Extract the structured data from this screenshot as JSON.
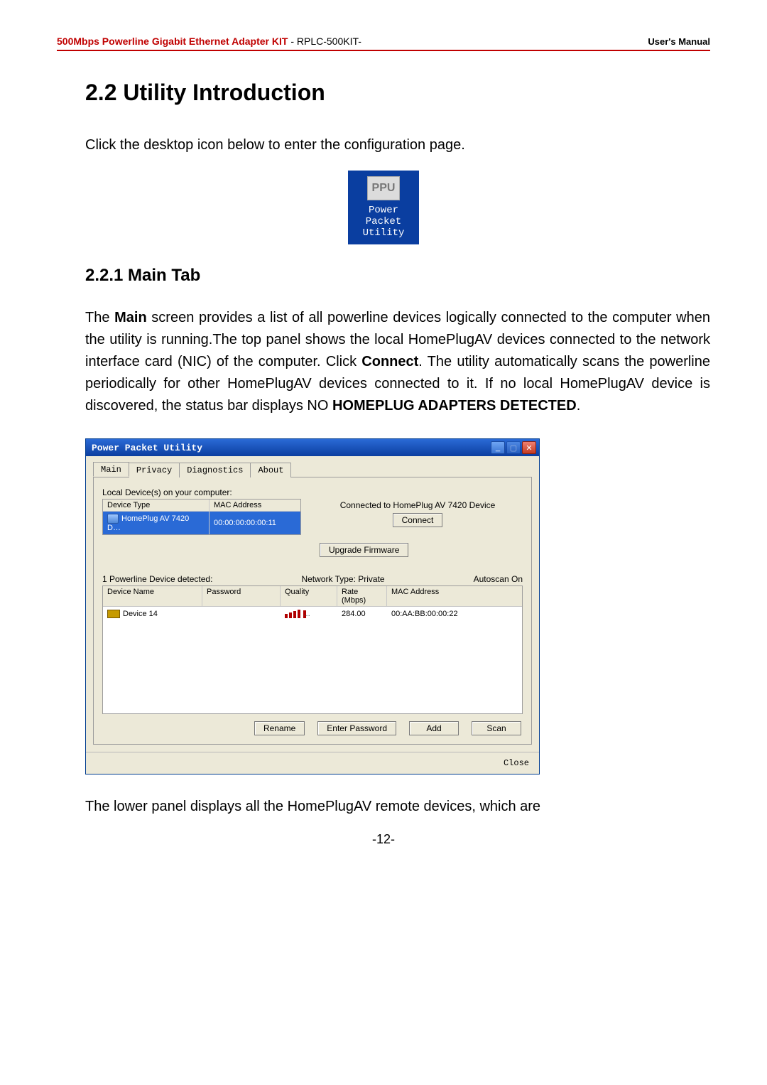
{
  "header": {
    "product": "500Mbps Powerline Gigabit Ethernet Adapter KIT",
    "separator": "  -",
    "model": " RPLC-500KIT-",
    "right": "User's Manual"
  },
  "section": {
    "number_title": "2.2 Utility Introduction",
    "intro": "Click the desktop icon below to enter the configuration page."
  },
  "desktop_icon": {
    "badge": "PPU",
    "line1": "Power",
    "line2": "Packet",
    "line3": "Utility"
  },
  "subsection": {
    "number_title": "2.2.1 Main Tab",
    "para_pre": "The ",
    "para_main": "Main",
    "para_mid1": " screen provides a list of all powerline devices logically connected to the computer when the utility is running.The top panel shows the local HomePlugAV devices connected to the network interface card (NIC) of the computer. Click ",
    "para_connect": "Connect",
    "para_mid2": ". The utility automatically scans the powerline periodically for other HomePlugAV devices connected to it. If no local HomePlugAV device is discovered, the status bar displays NO ",
    "para_h_adapters": "HOMEPLUG ADAPTERS DETECTED",
    "para_end": "."
  },
  "app": {
    "title": "Power Packet Utility",
    "tabs": [
      "Main",
      "Privacy",
      "Diagnostics",
      "About"
    ],
    "local_label": "Local Device(s) on your computer:",
    "local_headers": {
      "device_type": "Device Type",
      "mac": "MAC Address"
    },
    "local_row": {
      "device_type": "HomePlug AV 7420 D…",
      "mac": "00:00:00:00:00:11"
    },
    "connected_text": "Connected to HomePlug AV 7420 Device",
    "btn_connect": "Connect",
    "btn_upgrade": "Upgrade Firmware",
    "detected_text": "1 Powerline Device detected:",
    "network_type": "Network Type: Private",
    "autoscan": "Autoscan On",
    "net_headers": {
      "device_name": "Device Name",
      "password": "Password",
      "quality": "Quality",
      "rate": "Rate (Mbps)",
      "mac": "MAC Address"
    },
    "net_row": {
      "device_name": "Device 14",
      "password": "",
      "rate": "284.00",
      "mac": "00:AA:BB:00:00:22"
    },
    "btn_rename": "Rename",
    "btn_enter_pwd": "Enter Password",
    "btn_add": "Add",
    "btn_scan": "Scan",
    "btn_close": "Close"
  },
  "trailing_para": "The lower panel displays all the HomePlugAV remote devices, which are",
  "page_number": "-12-"
}
